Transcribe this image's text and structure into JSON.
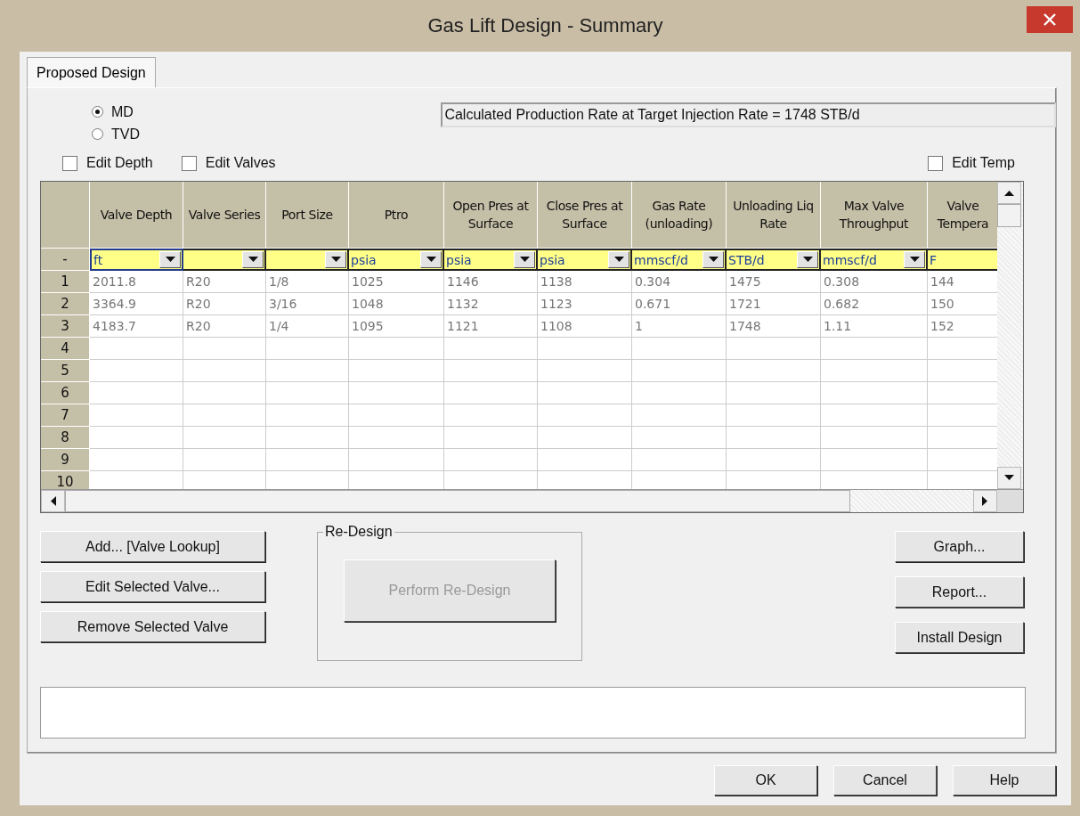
{
  "window": {
    "title": "Gas Lift Design - Summary"
  },
  "tabs": [
    {
      "label": "Proposed Design",
      "selected": true
    }
  ],
  "depth_mode": [
    {
      "label": "MD",
      "selected": true
    },
    {
      "label": "TVD",
      "selected": false
    }
  ],
  "production_rate": "Calculated Production Rate at Target Injection Rate = 1748 STB/d",
  "checkboxes_left": [
    {
      "label": "Edit Depth",
      "checked": false
    },
    {
      "label": "Edit Valves",
      "checked": false
    }
  ],
  "checkbox_right": {
    "label": "Edit Temp",
    "checked": false
  },
  "table": {
    "unit_row_label": "-",
    "columns": [
      {
        "header": "Valve Depth",
        "unit": "ft",
        "selected": true,
        "truncated": false
      },
      {
        "header": "Valve Series",
        "selected": false,
        "truncated": false
      },
      {
        "header": "Port Size",
        "selected": false,
        "truncated": false
      },
      {
        "header": "Ptro",
        "unit": "psia",
        "selected": false,
        "truncated": false
      },
      {
        "header": "Open Pres at Surface",
        "unit": "psia",
        "selected": false,
        "truncated": false
      },
      {
        "header": "Close Pres at Surface",
        "unit": "psia",
        "selected": false,
        "truncated": false
      },
      {
        "header": "Gas Rate (unloading)",
        "unit": "mmscf/d",
        "selected": false,
        "truncated": false
      },
      {
        "header": "Unloading Liq Rate",
        "unit": "STB/d",
        "selected": false,
        "truncated": false
      },
      {
        "header": "Max Valve Throughput",
        "unit": "mmscf/d",
        "selected": false,
        "truncated": false
      },
      {
        "header": "Valve Tempera",
        "unit": "F",
        "selected": false,
        "truncated": true
      }
    ],
    "rows": [
      {
        "number": "1",
        "cells": [
          "2011.8",
          "R20",
          "1/8",
          "1025",
          "1146",
          "1138",
          "0.304",
          "1475",
          "0.308",
          "144"
        ]
      },
      {
        "number": "2",
        "cells": [
          "3364.9",
          "R20",
          "3/16",
          "1048",
          "1132",
          "1123",
          "0.671",
          "1721",
          "0.682",
          "150"
        ]
      },
      {
        "number": "3",
        "cells": [
          "4183.7",
          "R20",
          "1/4",
          "1095",
          "1121",
          "1108",
          "1",
          "1748",
          "1.11",
          "152"
        ]
      },
      {
        "number": "4",
        "cells": []
      },
      {
        "number": "5",
        "cells": []
      },
      {
        "number": "6",
        "cells": []
      },
      {
        "number": "7",
        "cells": []
      },
      {
        "number": "8",
        "cells": []
      },
      {
        "number": "9",
        "cells": []
      },
      {
        "number": "10",
        "cells": []
      }
    ]
  },
  "left_buttons": [
    {
      "label": "Add... [Valve Lookup]"
    },
    {
      "label": "Edit Selected Valve..."
    },
    {
      "label": "Remove Selected Valve"
    }
  ],
  "redesign": {
    "title": "Re-Design",
    "button": {
      "label": "Perform Re-Design",
      "disabled": true
    }
  },
  "right_buttons": [
    {
      "label": "Graph..."
    },
    {
      "label": "Report..."
    },
    {
      "label": "Install Design"
    }
  ],
  "footer_buttons": [
    {
      "label": "OK"
    },
    {
      "label": "Cancel"
    },
    {
      "label": "Help"
    }
  ]
}
